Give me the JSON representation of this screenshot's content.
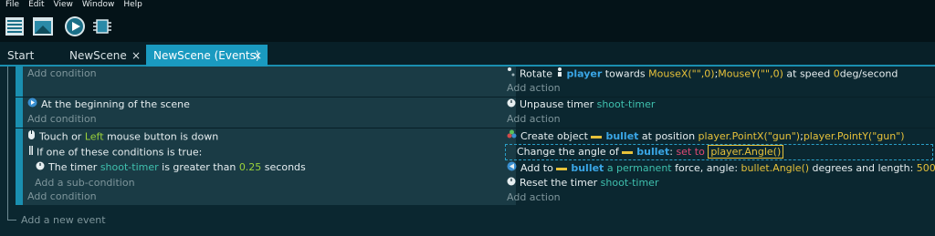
{
  "menu": [
    "File",
    "Edit",
    "View",
    "Window",
    "Help"
  ],
  "toolbar": {
    "icons": [
      "events-editor-icon",
      "scene-editor-icon",
      "preview-play-icon",
      "debugger-icon"
    ]
  },
  "tabs": [
    {
      "label": "Start Page",
      "closable": false,
      "active": false
    },
    {
      "label": "NewScene",
      "closable": true,
      "active": false
    },
    {
      "label": "NewScene (Events)",
      "closable": true,
      "active": true
    }
  ],
  "close_glyph": "×",
  "events": [
    {
      "conditions": [],
      "add_condition": "Add condition",
      "actions": [
        {
          "icon": "rotate-icon",
          "parts": [
            "Rotate ",
            "player",
            " towards ",
            "MouseX(\"\",0)",
            ";",
            "MouseY(\"\",0)",
            " at speed ",
            "0",
            "deg/second"
          ]
        }
      ],
      "add_action": "Add action"
    },
    {
      "conditions": [
        {
          "icon": "scene-start-icon",
          "text": "At the beginning of the scene"
        }
      ],
      "add_condition": "Add condition",
      "actions": [
        {
          "icon": "timer-icon",
          "parts": [
            "Unpause timer ",
            "shoot-timer"
          ]
        }
      ],
      "add_action": "Add action"
    },
    {
      "conditions": [
        {
          "icon": "mouse-icon",
          "parts": [
            "Touch or ",
            "Left",
            " mouse button is down"
          ]
        },
        {
          "icon": "or-icon",
          "text": "If one of these conditions is true:"
        },
        {
          "icon": "timer-icon",
          "parts": [
            "The timer ",
            "shoot-timer",
            " is greater than ",
            "0.25",
            " seconds"
          ]
        }
      ],
      "add_subcondition": "Add a sub-condition",
      "add_condition": "Add condition",
      "actions": [
        {
          "icon": "create-object-icon",
          "parts": [
            "Create object ",
            "bullet",
            " at position ",
            "player.PointX(\"gun\")",
            ";",
            "player.PointY(\"gun\")"
          ]
        },
        {
          "icon": "angle-icon",
          "parts": [
            "Change the angle of ",
            "bullet",
            ": ",
            "set to",
            " ",
            "player.Angle()"
          ]
        },
        {
          "icon": "force-icon",
          "parts": [
            "Add to ",
            "bullet",
            " ",
            "a permanent",
            " force, angle: ",
            "bullet.Angle()",
            " degrees and length: ",
            "500",
            " pixels"
          ]
        },
        {
          "icon": "timer-icon",
          "parts": [
            "Reset the timer ",
            "shoot-timer"
          ]
        }
      ],
      "add_action": "Add action"
    }
  ],
  "add_new_event": "Add a new event",
  "colors": {
    "background": "#0b2730",
    "accent": "#1a9ac0",
    "object": "#3aa6e6",
    "expression": "#e6c13a",
    "text_param": "#3fc0ae",
    "choice_param": "#9bd23a",
    "operator": "#e04a74"
  }
}
